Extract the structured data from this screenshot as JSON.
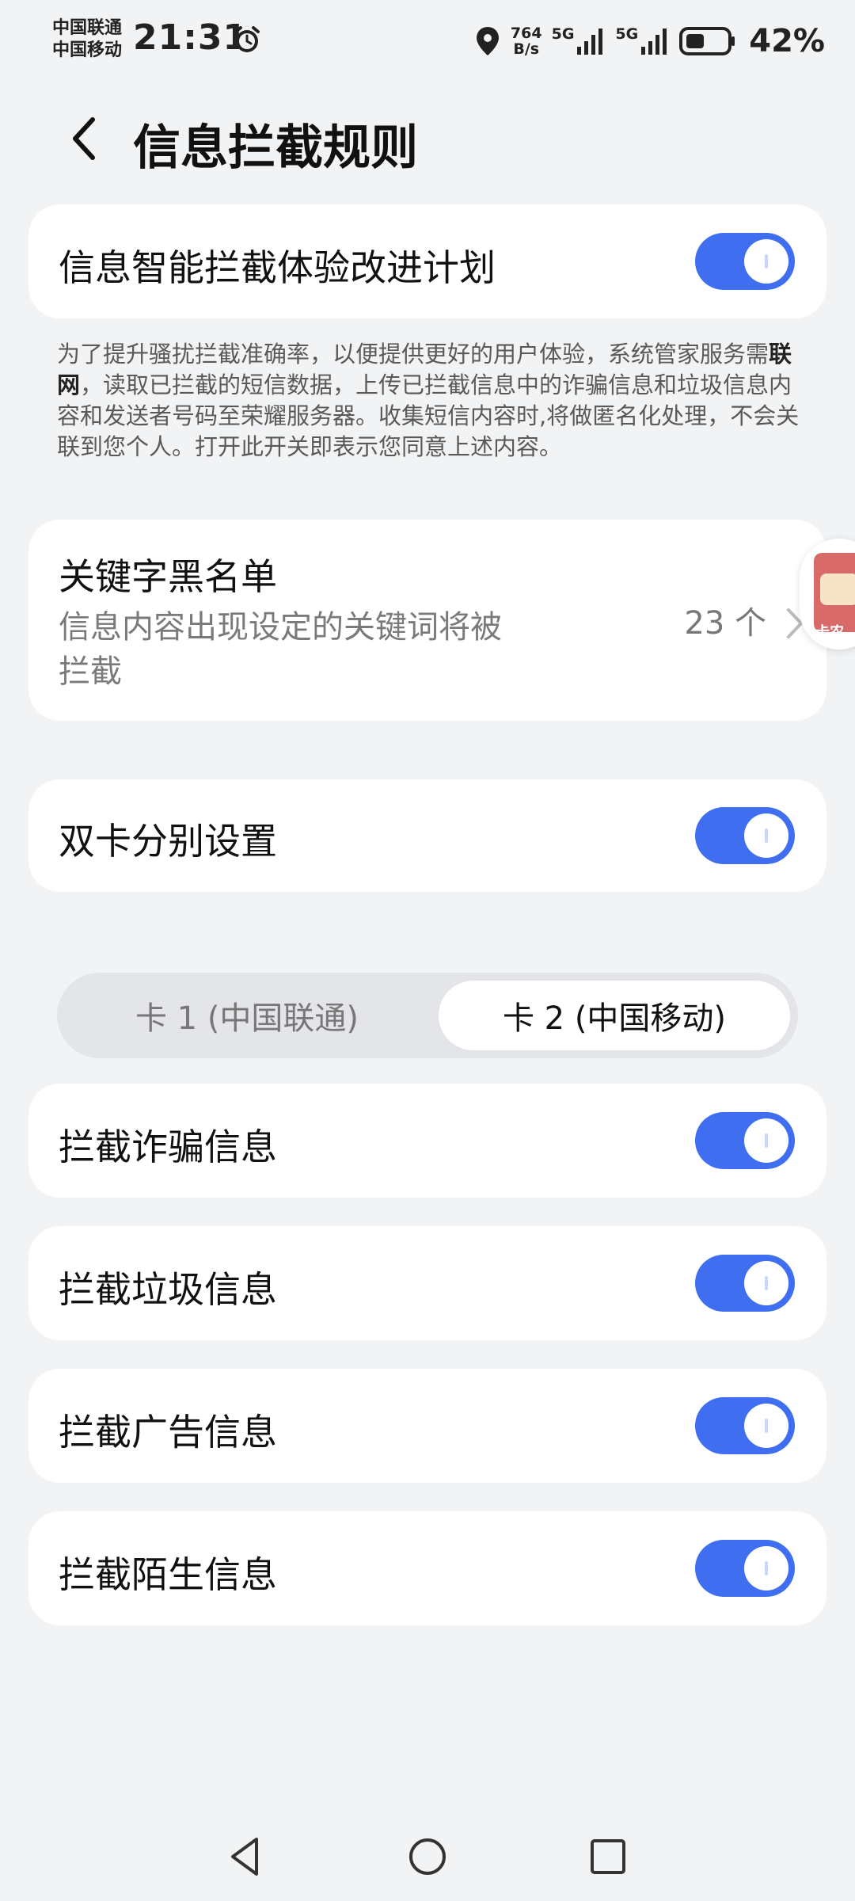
{
  "status_bar": {
    "carrier_1": "中国联通",
    "carrier_2": "中国移动",
    "time": "21:31",
    "net_speed_value": "764",
    "net_speed_unit": "B/s",
    "signal_1_label": "5G",
    "signal_2_label": "5G",
    "battery": "42%"
  },
  "header": {
    "title": "信息拦截规则"
  },
  "improvement_plan": {
    "label": "信息智能拦截体验改进计划",
    "enabled": true,
    "description_part1": "为了提升骚扰拦截准确率，以便提供更好的用户体验，系统管家服务需",
    "description_bold": "联网",
    "description_part2": "，读取已拦截的短信数据，上传已拦截信息中的诈骗信息和垃圾信息内容和发送者号码至荣耀服务器。收集短信内容时,将做匿名化处理，不会关联到您个人。打开此开关即表示您同意上述内容。"
  },
  "keyword_blacklist": {
    "title": "关键字黑名单",
    "subtitle": "信息内容出现设定的关键词将被拦截",
    "count": "23 个"
  },
  "floating_widget": {
    "label": "卡农"
  },
  "dual_sim": {
    "label": "双卡分别设置",
    "enabled": true
  },
  "sim_tabs": {
    "tab_1": "卡 1 (中国联通)",
    "tab_2": "卡 2 (中国移动)",
    "selected": "tab_2"
  },
  "rules": [
    {
      "label": "拦截诈骗信息",
      "enabled": true
    },
    {
      "label": "拦截垃圾信息",
      "enabled": true
    },
    {
      "label": "拦截广告信息",
      "enabled": true
    },
    {
      "label": "拦截陌生信息",
      "enabled": true
    }
  ],
  "colors": {
    "accent": "#3f6ff0",
    "background": "#f1f3f5",
    "card": "#ffffff"
  },
  "icons": {
    "back": "chevron-left-icon",
    "alarm": "alarm-clock-icon",
    "location": "location-pin-icon",
    "battery": "battery-icon",
    "nav_back": "triangle-back-icon",
    "nav_home": "circle-home-icon",
    "nav_recent": "square-recents-icon"
  }
}
